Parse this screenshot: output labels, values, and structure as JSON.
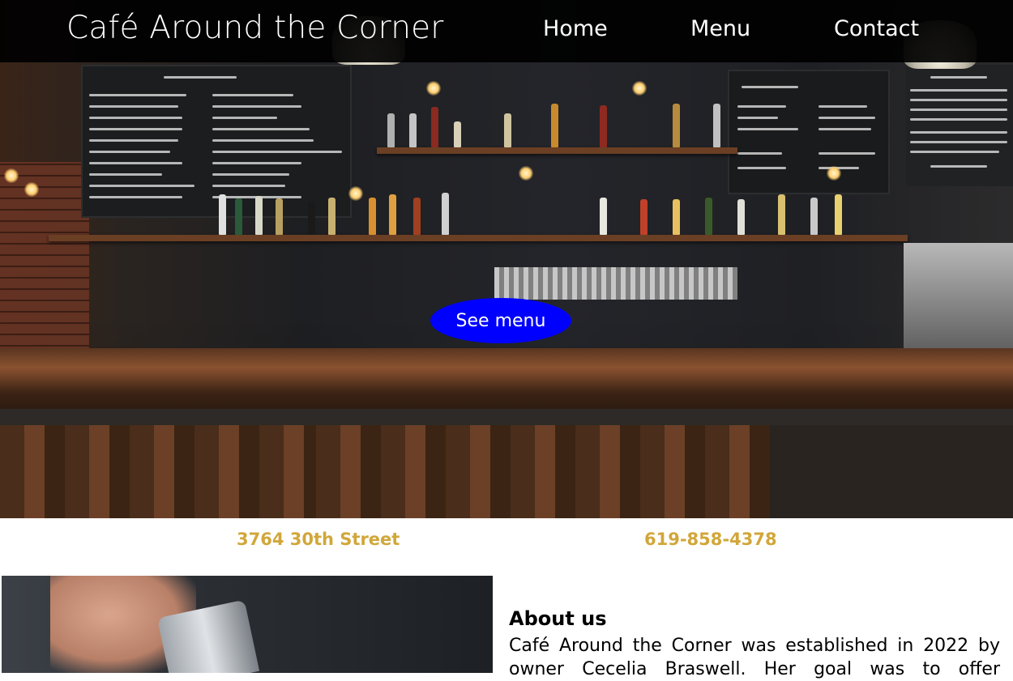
{
  "header": {
    "site_title": "Café Around the Corner",
    "nav": [
      {
        "label": "Home"
      },
      {
        "label": "Menu"
      },
      {
        "label": "Contact"
      }
    ]
  },
  "hero": {
    "cta_label": "See menu"
  },
  "info": {
    "address": "3764 30th Street",
    "phone": "619-858-4378"
  },
  "about": {
    "heading": "About us",
    "text": "Café Around the Corner was established in 2022 by owner Cecelia Braswell. Her goal was to offer"
  },
  "colors": {
    "header_bg": "#000000",
    "cta_bg": "#0000ff",
    "info_text": "#d1a73a"
  },
  "icons": []
}
